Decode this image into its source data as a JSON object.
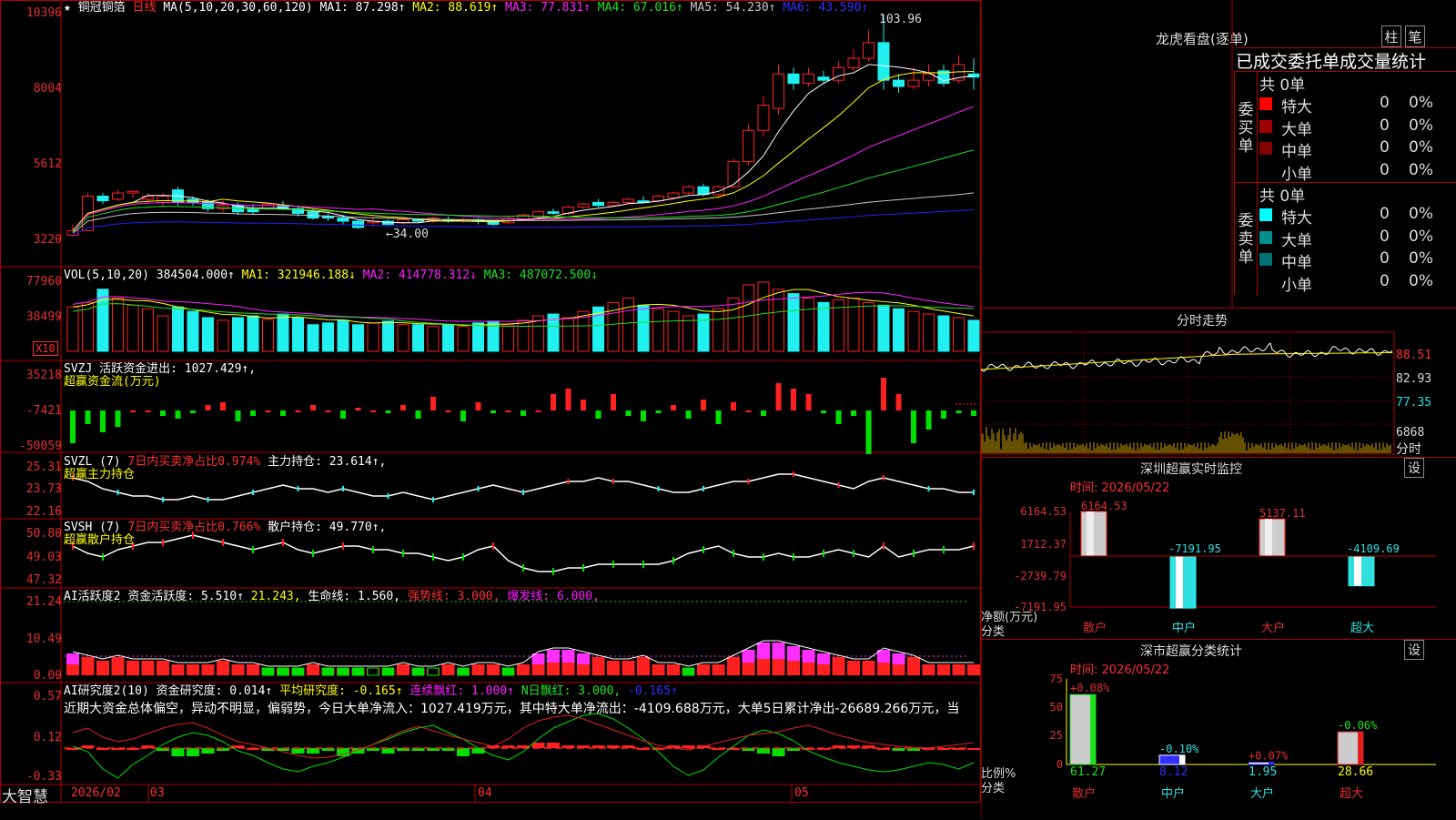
{
  "colors": {
    "up": "#ff2020",
    "down": "#20f0f0",
    "ma1": "#ffffff",
    "ma2": "#ffff00",
    "ma3": "#ff20ff",
    "ma4": "#20e020",
    "ma5": "#c8c8c8",
    "ma6": "#2020ff",
    "border": "#b00000",
    "green": "#00e000"
  },
  "main": {
    "title_prefix": "★",
    "stock_name": "铜冠铜箔",
    "period": "日线",
    "ma_label": "MA(5,10,20,30,60,120)",
    "ma_values": [
      "MA1: 87.298↑",
      "MA2: 88.619↑",
      "MA3: 77.831↑",
      "MA4: 67.016↑",
      "MA5: 54.230↑",
      "MA6: 43.590↑"
    ],
    "yticks": [
      "10396",
      "8004",
      "5612",
      "3220"
    ],
    "high_label": "103.96",
    "low_label": "←34.00"
  },
  "vol": {
    "label": "VOL(5,10,20)",
    "value": "384504.000↑",
    "ma1": "MA1: 321946.188↓",
    "ma2": "MA2: 414778.312↓",
    "ma3": "MA3: 487072.500↓",
    "yticks": [
      "77960",
      "38499"
    ],
    "unit": "X10"
  },
  "svzj": {
    "label": "SVZJ",
    "title": "活跃资金进出: 1027.429↑,",
    "subtitle": "超赢资金流(万元)",
    "yticks": [
      "35218",
      "-7421",
      "-50059"
    ]
  },
  "svzl": {
    "label": "SVZL (7)",
    "ratio": "7日内买卖净占比0.974%",
    "hold": "主力持仓: 23.614↑,",
    "subtitle": "超赢主力持仓",
    "yticks": [
      "25.31",
      "23.73",
      "22.16"
    ]
  },
  "svsh": {
    "label": "SVSH (7)",
    "ratio": "7日内买卖净占比0.766%",
    "hold": "散户持仓: 49.770↑,",
    "subtitle": "超赢散户持仓",
    "yticks": [
      "50.80",
      "49.03",
      "47.32"
    ]
  },
  "ai2": {
    "label": "AI活跃度2",
    "a": "资金活跃度: 5.510↑",
    "b": "21.243,",
    "c": "生命线: 1.560,",
    "d": "强势线: 3.000,",
    "e": "爆发线: 6.000,",
    "yticks": [
      "21.24",
      "10.49",
      "0.00"
    ]
  },
  "ai3": {
    "label": "AI研究度2(10)",
    "a": "资金研究度: 0.014↑",
    "b": "平均研究度: -0.165↑",
    "c": "连续飘红: 1.000↑",
    "d": "N日飘红: 3.000,",
    "e": "-0.165↑",
    "text": "近期大资金总体偏空，异动不明显，偏弱势，今日大单净流入：1027.419万元，其中特大单净流出：-4109.688万元，大单5日累计净出-26689.266万元，当",
    "yticks": [
      "0.57",
      "0.12",
      "-0.33"
    ]
  },
  "bottom": {
    "brand": "大智慧",
    "year": "2026/02",
    "months": [
      "03",
      "04",
      "05"
    ]
  },
  "right": {
    "longhu_title": "龙虎看盘(逐单)",
    "btn1": "柱",
    "btn2": "笔",
    "tabs": [
      "已成交",
      "委托单",
      "成交量统计"
    ],
    "buy": {
      "side": [
        "委",
        "买",
        "单"
      ],
      "total": "共 0单",
      "rows": [
        {
          "name": "特大",
          "n": "0",
          "p": "0%",
          "color": "#ff0000"
        },
        {
          "name": "大单",
          "n": "0",
          "p": "0%",
          "color": "#a00000"
        },
        {
          "name": "中单",
          "n": "0",
          "p": "0%",
          "color": "#800000"
        },
        {
          "name": "小单",
          "n": "0",
          "p": "0%",
          "color": "#000000"
        }
      ]
    },
    "sell": {
      "side": [
        "委",
        "卖",
        "单"
      ],
      "total": "共 0单",
      "rows": [
        {
          "name": "特大",
          "n": "0",
          "p": "0%",
          "color": "#00ffff"
        },
        {
          "name": "大单",
          "n": "0",
          "p": "0%",
          "color": "#009090"
        },
        {
          "name": "中单",
          "n": "0",
          "p": "0%",
          "color": "#007070"
        },
        {
          "name": "小单",
          "n": "0",
          "p": "0%",
          "color": "#000000"
        }
      ]
    },
    "intraday": {
      "title": "分时走势",
      "y": [
        "88.51",
        "82.93",
        "77.35"
      ],
      "vol": "6868",
      "vol_label": "分时"
    },
    "sz_monitor": {
      "title": "深圳超赢实时监控",
      "set": "设",
      "time": "时间: 2026/05/22",
      "y": [
        "6164.53",
        "1712.37",
        "-2739.79",
        "-7191.95"
      ],
      "ylabel": "净额(万元)",
      "xlabel": "分类",
      "cats": [
        "散户",
        "中户",
        "大户",
        "超大"
      ],
      "vals": [
        "6164.53",
        "-7191.95",
        "5137.11",
        "-4109.69"
      ]
    },
    "sz_class": {
      "title": "深市超赢分类统计",
      "set": "设",
      "time": "时间: 2026/05/22",
      "y": [
        "75",
        "50",
        "25",
        "0"
      ],
      "ylabel": "比例%",
      "xlabel": "分类",
      "cats": [
        "散户",
        "中户",
        "大户",
        "超大"
      ],
      "pct": [
        "+0.08%",
        "-0.10%",
        "+0.07%",
        "-0.06%"
      ],
      "vals": [
        "61.27",
        "8.12",
        "1.95",
        "28.66"
      ]
    }
  },
  "chart_data": {
    "type": "candlestick",
    "title": "铜冠铜箔 日线",
    "ylim": [
      3220,
      10396
    ],
    "candles": [
      [
        3350,
        3500,
        3300,
        3700
      ],
      [
        3500,
        4600,
        3480,
        4700
      ],
      [
        4600,
        4450,
        4350,
        4700
      ],
      [
        4500,
        4700,
        4450,
        4800
      ],
      [
        4700,
        4750,
        4550,
        4800
      ],
      [
        4500,
        4600,
        4400,
        4700
      ],
      [
        4400,
        4600,
        4300,
        4700
      ],
      [
        4800,
        4400,
        4300,
        4900
      ],
      [
        4500,
        4400,
        4300,
        4600
      ],
      [
        4400,
        4200,
        4100,
        4500
      ],
      [
        4200,
        4300,
        4100,
        4450
      ],
      [
        4300,
        4100,
        4000,
        4400
      ],
      [
        4200,
        4100,
        4000,
        4350
      ],
      [
        4200,
        4350,
        4150,
        4400
      ],
      [
        4300,
        4200,
        4150,
        4450
      ],
      [
        4200,
        4050,
        3950,
        4300
      ],
      [
        4100,
        3900,
        3850,
        4200
      ],
      [
        3950,
        3900,
        3800,
        4050
      ],
      [
        3900,
        3800,
        3700,
        4000
      ],
      [
        3800,
        3600,
        3550,
        3850
      ],
      [
        3750,
        3800,
        3650,
        3900
      ],
      [
        3800,
        3700,
        3650,
        3850
      ],
      [
        3750,
        3850,
        3700,
        3900
      ],
      [
        3850,
        3800,
        3750,
        3900
      ],
      [
        3800,
        3900,
        3750,
        3950
      ],
      [
        3850,
        3800,
        3750,
        3950
      ],
      [
        3800,
        3850,
        3750,
        3900
      ],
      [
        3850,
        3800,
        3700,
        3900
      ],
      [
        3800,
        3700,
        3650,
        3850
      ],
      [
        3750,
        3900,
        3700,
        3950
      ],
      [
        3850,
        4000,
        3800,
        4050
      ],
      [
        3950,
        4100,
        3900,
        4150
      ],
      [
        4100,
        4050,
        4000,
        4200
      ],
      [
        4050,
        4250,
        4000,
        4300
      ],
      [
        4250,
        4350,
        4200,
        4400
      ],
      [
        4400,
        4300,
        4250,
        4500
      ],
      [
        4300,
        4400,
        4250,
        4450
      ],
      [
        4400,
        4500,
        4350,
        4550
      ],
      [
        4450,
        4400,
        4350,
        4600
      ],
      [
        4450,
        4600,
        4400,
        4650
      ],
      [
        4550,
        4700,
        4500,
        4750
      ],
      [
        4700,
        4900,
        4650,
        4950
      ],
      [
        4900,
        4650,
        4600,
        5000
      ],
      [
        4650,
        4900,
        4600,
        4950
      ],
      [
        4900,
        5700,
        4850,
        5800
      ],
      [
        5700,
        6700,
        5600,
        6900
      ],
      [
        6700,
        7500,
        6500,
        7800
      ],
      [
        7400,
        8500,
        7200,
        8800
      ],
      [
        8500,
        8200,
        8000,
        8700
      ],
      [
        8200,
        8500,
        8100,
        8700
      ],
      [
        8400,
        8300,
        8200,
        8600
      ],
      [
        8300,
        8700,
        8200,
        8900
      ],
      [
        8700,
        9000,
        8600,
        9300
      ],
      [
        9000,
        9500,
        8900,
        9900
      ],
      [
        9500,
        8300,
        8000,
        10396
      ],
      [
        8300,
        8100,
        7900,
        8500
      ],
      [
        8100,
        8300,
        8000,
        8700
      ],
      [
        8300,
        8500,
        8100,
        8800
      ],
      [
        8600,
        8200,
        8100,
        8800
      ],
      [
        8300,
        8800,
        8200,
        9100
      ],
      [
        8500,
        8400,
        8000,
        9000
      ]
    ]
  }
}
